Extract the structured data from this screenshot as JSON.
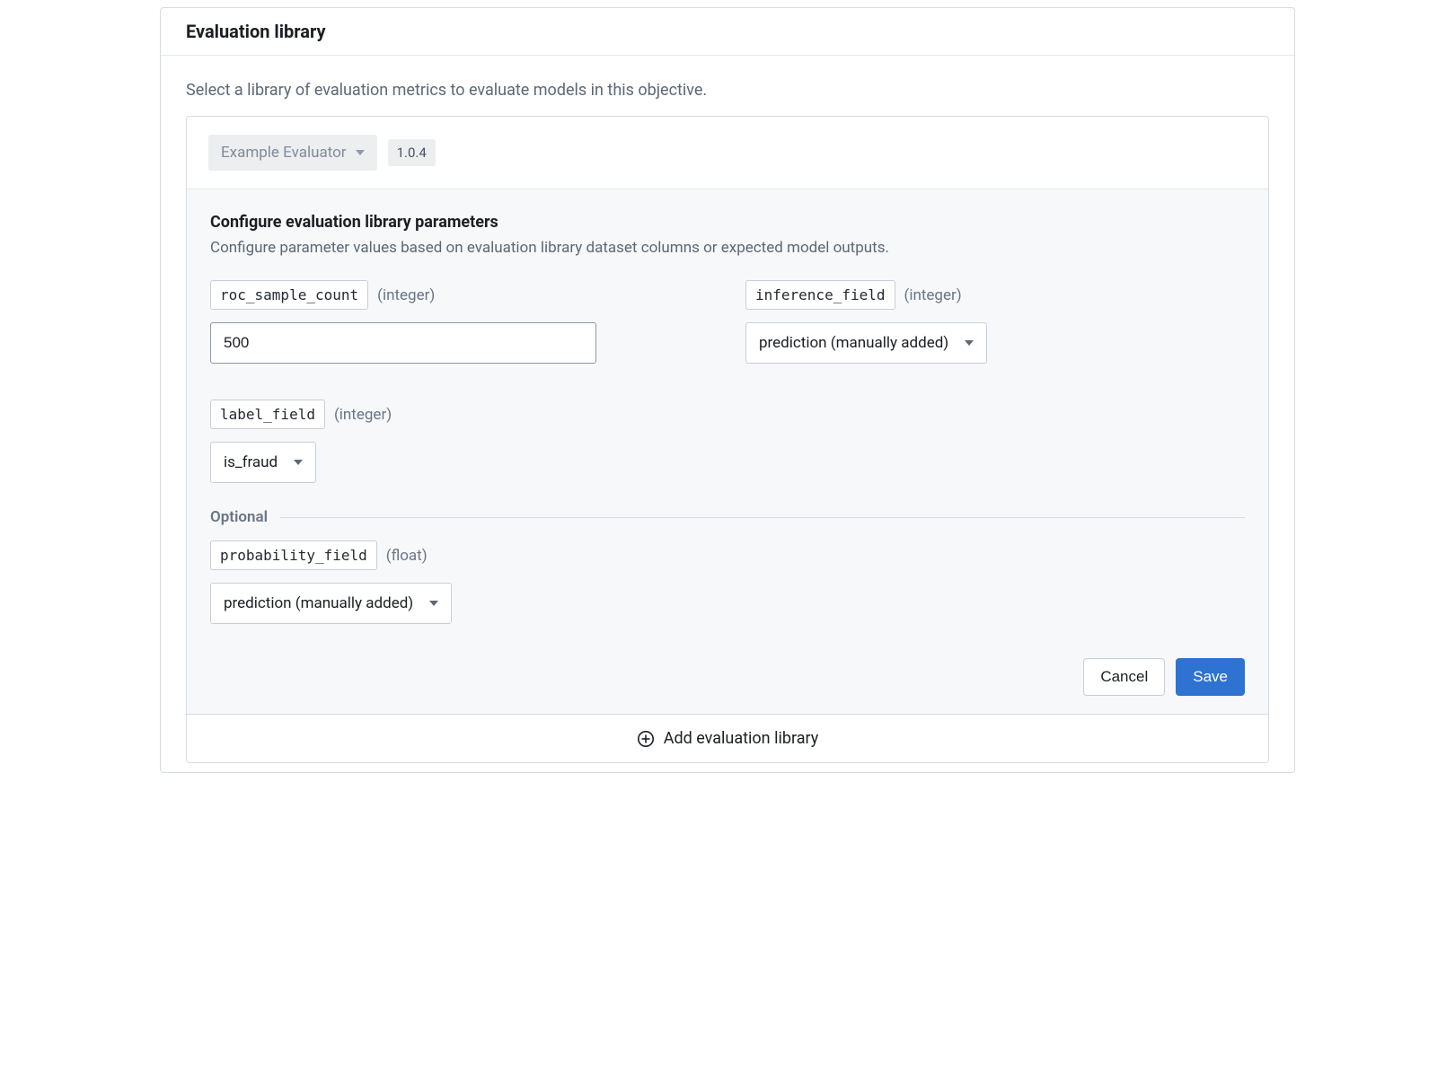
{
  "header": {
    "title": "Evaluation library"
  },
  "description": "Select a library of evaluation metrics to evaluate models in this objective.",
  "library": {
    "selected_name": "Example Evaluator",
    "version": "1.0.4"
  },
  "config": {
    "title": "Configure evaluation library parameters",
    "description": "Configure parameter values based on evaluation library dataset columns or expected model outputs.",
    "optional_label": "Optional",
    "params": {
      "roc_sample_count": {
        "name": "roc_sample_count",
        "type_label": "(integer)",
        "value": "500"
      },
      "inference_field": {
        "name": "inference_field",
        "type_label": "(integer)",
        "selected": "prediction (manually added)"
      },
      "label_field": {
        "name": "label_field",
        "type_label": "(integer)",
        "selected": "is_fraud"
      },
      "probability_field": {
        "name": "probability_field",
        "type_label": "(float)",
        "selected": "prediction (manually added)"
      }
    }
  },
  "actions": {
    "cancel": "Cancel",
    "save": "Save"
  },
  "footer": {
    "add_library": "Add evaluation library"
  }
}
